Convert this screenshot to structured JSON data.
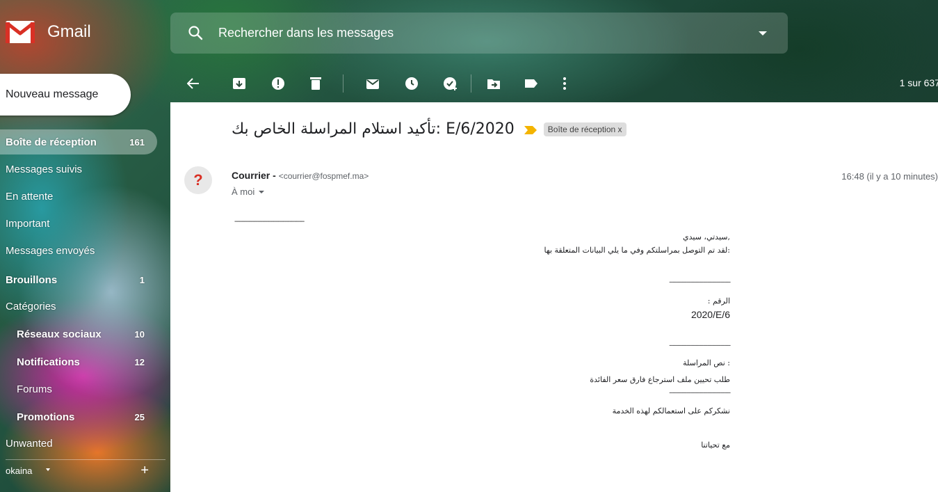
{
  "app": {
    "logo_text": "Gmail"
  },
  "search": {
    "placeholder": "Rechercher dans les messages"
  },
  "toolbar": {
    "icons": [
      "back-arrow-icon",
      "archive-icon",
      "report-spam-icon",
      "delete-icon",
      "mark-unread-icon",
      "snooze-icon",
      "add-to-tasks-icon",
      "move-to-icon",
      "label-icon",
      "more-options-icon"
    ],
    "pager": "1 sur 637"
  },
  "sidebar": {
    "compose": "Nouveau message",
    "items": [
      {
        "label": "Boîte de réception",
        "count": "161"
      },
      {
        "label": "Messages suivis",
        "count": ""
      },
      {
        "label": "En attente",
        "count": ""
      },
      {
        "label": "Important",
        "count": ""
      },
      {
        "label": "Messages envoyés",
        "count": ""
      },
      {
        "label": "Brouillons",
        "count": "1"
      },
      {
        "label": "Catégories",
        "count": ""
      },
      {
        "label": "Réseaux sociaux",
        "count": "10"
      },
      {
        "label": "Notifications",
        "count": "12"
      },
      {
        "label": "Forums",
        "count": ""
      },
      {
        "label": "Promotions",
        "count": "25"
      },
      {
        "label": "Unwanted",
        "count": ""
      }
    ],
    "account": "okaina"
  },
  "email": {
    "subject": "تأكيد استلام المراسلة الخاص بك: E/6/2020",
    "label_chip": "Boîte de réception x",
    "avatar": "?",
    "sender_name": "Courrier -",
    "sender_email": "<courrier@fospmef.ma>",
    "to": "À moi",
    "time": "16:48 (il y a 10 minutes)",
    "dash_top": "-------------------------------------------",
    "greeting": "سيدتي، سيدي,",
    "intro": "لقد تم التوصل بمراسلتكم وفي ما يلي البيانات المتعلقة بها:",
    "dash1": "-------------------------------------------",
    "number_label": ": الرقم",
    "number_value": "2020/E/6",
    "dash2": "-------------------------------------------",
    "text_label": "نص المراسلة :",
    "text_value": "طلب تحيين ملف استرجاع فارق سعر الفائدة",
    "dash3": "-------------------------------------------",
    "thanks": "نشكركم على استعمالكم لهذه الخدمة",
    "closing": "مع تحياتنا"
  },
  "colors": {
    "gmail_red": "#d93025",
    "important_marker": "#f4b400",
    "pane_bg": "#ffffff"
  }
}
